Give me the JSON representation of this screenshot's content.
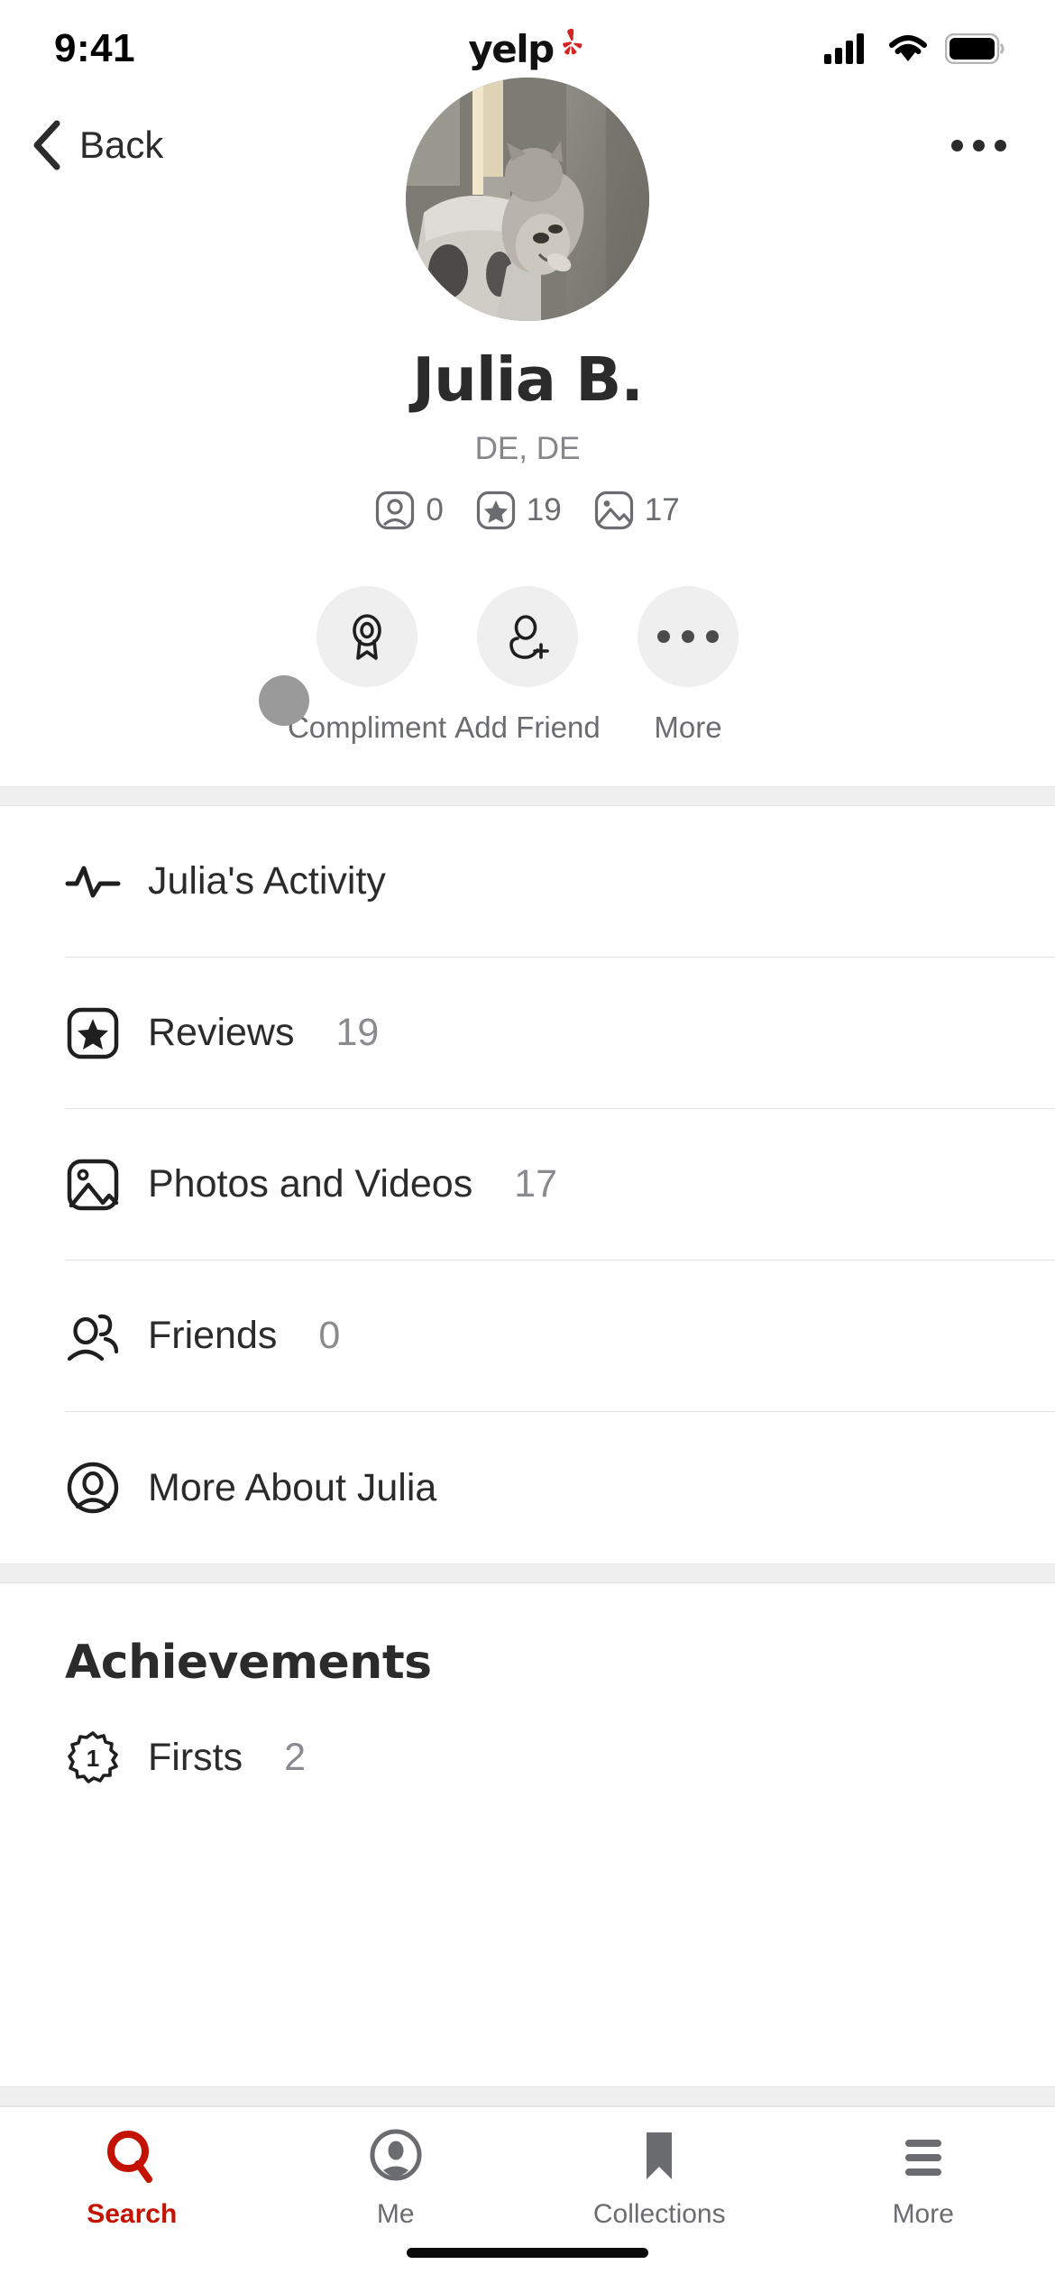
{
  "status_bar": {
    "time": "9:41",
    "brand": "yelp",
    "signal_icon": "cellular-signal-icon",
    "wifi_icon": "wifi-icon",
    "battery_icon": "battery-icon"
  },
  "nav": {
    "back_label": "Back",
    "back_icon": "chevron-left-icon",
    "overflow_icon": "ellipsis-icon"
  },
  "profile": {
    "avatar_icon": "user-avatar-photo",
    "name": "Julia B.",
    "location": "DE, DE",
    "stats": [
      {
        "icon": "friends-badge-icon",
        "value": "0"
      },
      {
        "icon": "star-badge-icon",
        "value": "19"
      },
      {
        "icon": "photo-badge-icon",
        "value": "17"
      }
    ],
    "actions": [
      {
        "icon": "award-ribbon-icon",
        "label": "Compliment"
      },
      {
        "icon": "add-friend-icon",
        "label": "Add Friend"
      },
      {
        "icon": "ellipsis-icon",
        "label": "More"
      }
    ]
  },
  "activity_list": [
    {
      "icon": "pulse-activity-icon",
      "label": "Julia's Activity",
      "count": ""
    },
    {
      "icon": "star-square-icon",
      "label": "Reviews",
      "count": "19"
    },
    {
      "icon": "photo-square-icon",
      "label": "Photos and Videos",
      "count": "17"
    },
    {
      "icon": "people-icon",
      "label": "Friends",
      "count": "0"
    },
    {
      "icon": "person-circle-icon",
      "label": "More About Julia",
      "count": ""
    }
  ],
  "achievements": {
    "title": "Achievements",
    "items": [
      {
        "icon": "firsts-badge-icon",
        "label": "Firsts",
        "count": "2"
      }
    ]
  },
  "tabbar": {
    "items": [
      {
        "icon": "search-icon",
        "label": "Search",
        "active": true
      },
      {
        "icon": "me-person-icon",
        "label": "Me",
        "active": false
      },
      {
        "icon": "bookmark-icon",
        "label": "Collections",
        "active": false
      },
      {
        "icon": "hamburger-menu-icon",
        "label": "More",
        "active": false
      }
    ]
  },
  "colors": {
    "yelp_red": "#c41200",
    "text_primary": "#2b2b2b",
    "text_secondary": "#8a8b8f",
    "band": "#f0eff0"
  }
}
